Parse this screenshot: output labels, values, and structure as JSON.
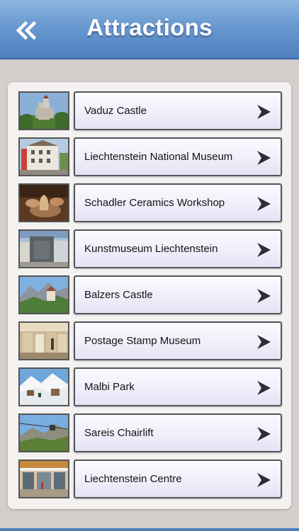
{
  "header": {
    "title": "Attractions",
    "back_icon": "double-chevron-left-icon"
  },
  "colors": {
    "header_top": "#8fb5e1",
    "header_bottom": "#4f7fbf",
    "background": "#d3cecc",
    "button_border": "#55565c",
    "arrow": "#2b2d38"
  },
  "items": [
    {
      "label": "Vaduz Castle"
    },
    {
      "label": "Liechtenstein National Museum"
    },
    {
      "label": "Schadler Ceramics Workshop"
    },
    {
      "label": "Kunstmuseum Liechtenstein"
    },
    {
      "label": "Balzers Castle"
    },
    {
      "label": "Postage Stamp Museum"
    },
    {
      "label": "Malbi Park"
    },
    {
      "label": "Sareis Chairlift"
    },
    {
      "label": "Liechtenstein Centre"
    }
  ]
}
